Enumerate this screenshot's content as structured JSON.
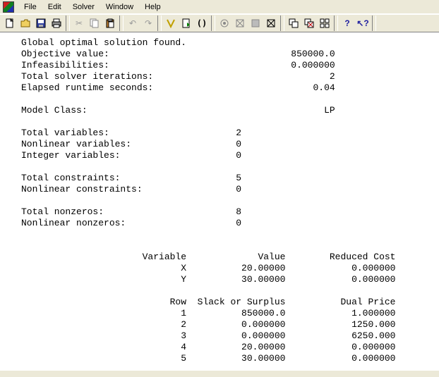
{
  "menu": {
    "file": "File",
    "edit": "Edit",
    "solver": "Solver",
    "window": "Window",
    "help": "Help"
  },
  "toolbar_icons": {
    "new": "new-icon",
    "open": "open-icon",
    "save": "save-icon",
    "print": "print-icon",
    "cut": "cut-icon",
    "copy": "copy-icon",
    "paste": "paste-icon",
    "undo": "undo-icon",
    "redo": "redo-icon",
    "find": "find-icon",
    "goto": "goto-icon",
    "match": "match-paren-icon",
    "solve": "solve-icon",
    "solution": "solution-icon",
    "matrix": "matrix-picture-icon",
    "options": "options-icon",
    "tile_h": "send-to-back-icon",
    "tile_v": "close-all-icon",
    "cascade": "tile-icon",
    "help": "help-icon",
    "context_help": "context-help-icon"
  },
  "report": {
    "header": "Global optimal solution found.",
    "kv1": [
      {
        "label": "Objective value:",
        "value": "850000.0"
      },
      {
        "label": "Infeasibilities:",
        "value": "0.000000"
      },
      {
        "label": "Total solver iterations:",
        "value": "2"
      },
      {
        "label": "Elapsed runtime seconds:",
        "value": "0.04"
      }
    ],
    "model_class": {
      "label": "Model Class:",
      "value": "LP"
    },
    "kv2": [
      {
        "label": "Total variables:",
        "value": "2"
      },
      {
        "label": "Nonlinear variables:",
        "value": "0"
      },
      {
        "label": "Integer variables:",
        "value": "0"
      }
    ],
    "kv3": [
      {
        "label": "Total constraints:",
        "value": "5"
      },
      {
        "label": "Nonlinear constraints:",
        "value": "0"
      }
    ],
    "kv4": [
      {
        "label": "Total nonzeros:",
        "value": "8"
      },
      {
        "label": "Nonlinear nonzeros:",
        "value": "0"
      }
    ],
    "var_header": {
      "c1": "Variable",
      "c2": "Value",
      "c3": "Reduced Cost"
    },
    "vars": [
      {
        "c1": "X",
        "c2": "20.00000",
        "c3": "0.000000"
      },
      {
        "c1": "Y",
        "c2": "30.00000",
        "c3": "0.000000"
      }
    ],
    "row_header": {
      "c1": "Row",
      "c2": "Slack or Surplus",
      "c3": "Dual Price"
    },
    "rows": [
      {
        "c1": "1",
        "c2": "850000.0",
        "c3": "1.000000"
      },
      {
        "c1": "2",
        "c2": "0.000000",
        "c3": "1250.000"
      },
      {
        "c1": "3",
        "c2": "0.000000",
        "c3": "6250.000"
      },
      {
        "c1": "4",
        "c2": "20.00000",
        "c3": "0.000000"
      },
      {
        "c1": "5",
        "c2": "30.00000",
        "c3": "0.000000"
      }
    ]
  }
}
